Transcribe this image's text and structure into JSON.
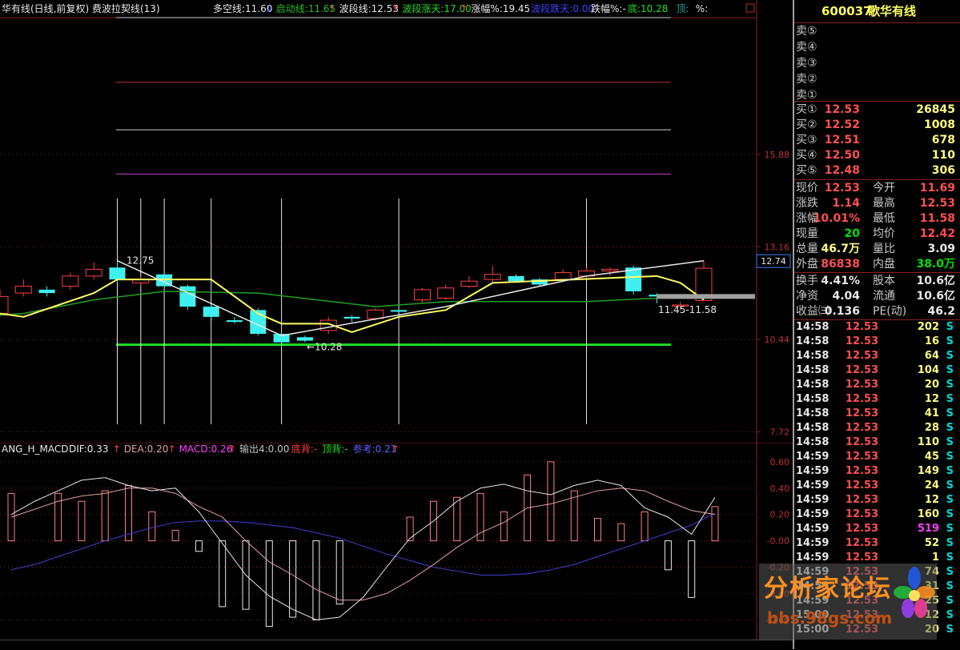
{
  "header": {
    "title": "华有线(日线,前复权) 费波拉契线(13)",
    "indicators": [
      {
        "label": "多空线:11.60",
        "arrow": "↓",
        "color": "#e8e8e8"
      },
      {
        "label": "启动线:11.65",
        "arrow": "↑",
        "color": "#20c020"
      },
      {
        "label": "波段线:12.53",
        "arrow": "↑",
        "color": "#e8e8e8"
      },
      {
        "label": "波段涨天:17.00",
        "arrow": "↑",
        "color": "#20e020"
      },
      {
        "label": "涨幅%:19.45",
        "arrow": "",
        "color": "#e8e8e8"
      },
      {
        "label": "波段跌天:0.00",
        "arrow": "",
        "color": "#4040ff"
      },
      {
        "label": "跌幅%:-",
        "arrow": "",
        "color": "#e8e8e8"
      },
      {
        "label": "底:10.28",
        "arrow": "",
        "color": "#20e020"
      },
      {
        "label": "顶:",
        "arrow": "",
        "color": "#20a0a0"
      },
      {
        "label": "%:",
        "arrow": "",
        "color": "#e8e8e8"
      }
    ]
  },
  "chart_data": [
    {
      "type": "candlestick",
      "title": "华有线(日线,前复权) 费波拉契线(13)",
      "y_ticks": [
        "15.88",
        "13.16",
        "10.44",
        "7.72"
      ],
      "current_price_tag": "12.74",
      "y_range": [
        7.4,
        19.9
      ],
      "annotations": {
        "high_label": "12.75",
        "low_label": "10.28",
        "range_label": "11.45-11.58"
      },
      "horizontal_levels": [
        {
          "value": 18.0,
          "color": "#c03030"
        },
        {
          "value": 16.6,
          "color": "#d0d0d0"
        },
        {
          "value": 15.3,
          "color": "#d040d0"
        },
        {
          "value": 10.28,
          "color": "#20e020"
        }
      ],
      "fib_vertical_days": [
        5,
        6,
        7,
        9,
        12,
        17,
        25,
        41
      ],
      "candles": [
        {
          "o": 11.2,
          "h": 11.9,
          "l": 11.1,
          "c": 11.7
        },
        {
          "o": 11.8,
          "h": 12.2,
          "l": 11.7,
          "c": 12.0
        },
        {
          "o": 11.9,
          "h": 12.0,
          "l": 11.7,
          "c": 11.8
        },
        {
          "o": 12.0,
          "h": 12.4,
          "l": 11.9,
          "c": 12.3
        },
        {
          "o": 12.3,
          "h": 12.7,
          "l": 12.2,
          "c": 12.5
        },
        {
          "o": 12.55,
          "h": 12.75,
          "l": 12.1,
          "c": 12.2
        },
        {
          "o": 12.1,
          "h": 12.3,
          "l": 12.0,
          "c": 12.2
        },
        {
          "o": 12.35,
          "h": 12.4,
          "l": 11.95,
          "c": 12.0
        },
        {
          "o": 12.0,
          "h": 12.05,
          "l": 11.3,
          "c": 11.4
        },
        {
          "o": 11.4,
          "h": 11.45,
          "l": 10.95,
          "c": 11.1
        },
        {
          "o": 11.0,
          "h": 11.1,
          "l": 10.9,
          "c": 10.95
        },
        {
          "o": 11.3,
          "h": 11.35,
          "l": 10.55,
          "c": 10.6
        },
        {
          "o": 10.6,
          "h": 10.65,
          "l": 10.28,
          "c": 10.35
        },
        {
          "o": 10.5,
          "h": 10.55,
          "l": 10.35,
          "c": 10.4
        },
        {
          "o": 10.7,
          "h": 11.1,
          "l": 10.6,
          "c": 11.0
        },
        {
          "o": 11.1,
          "h": 11.15,
          "l": 10.95,
          "c": 11.05
        },
        {
          "o": 11.05,
          "h": 11.35,
          "l": 11.0,
          "c": 11.3
        },
        {
          "o": 11.3,
          "h": 11.35,
          "l": 11.2,
          "c": 11.25
        },
        {
          "o": 11.6,
          "h": 11.95,
          "l": 11.5,
          "c": 11.9
        },
        {
          "o": 11.65,
          "h": 12.05,
          "l": 11.6,
          "c": 11.95
        },
        {
          "o": 12.0,
          "h": 12.3,
          "l": 11.95,
          "c": 12.15
        },
        {
          "o": 12.2,
          "h": 12.6,
          "l": 12.1,
          "c": 12.35
        },
        {
          "o": 12.3,
          "h": 12.35,
          "l": 12.1,
          "c": 12.15
        },
        {
          "o": 12.2,
          "h": 12.25,
          "l": 12.0,
          "c": 12.05
        },
        {
          "o": 12.2,
          "h": 12.5,
          "l": 12.15,
          "c": 12.4
        },
        {
          "o": 12.3,
          "h": 12.55,
          "l": 12.2,
          "c": 12.45
        },
        {
          "o": 12.45,
          "h": 12.55,
          "l": 12.3,
          "c": 12.5
        },
        {
          "o": 12.55,
          "h": 12.6,
          "l": 11.75,
          "c": 11.85
        },
        {
          "o": 11.75,
          "h": 11.8,
          "l": 11.5,
          "c": 11.7
        },
        {
          "o": 11.45,
          "h": 11.55,
          "l": 11.3,
          "c": 11.45
        },
        {
          "o": 11.58,
          "h": 12.74,
          "l": 11.58,
          "c": 12.53
        }
      ],
      "lines": [
        {
          "name": "启动线",
          "color": "#20a020",
          "points": [
            [
              0,
              11.15
            ],
            [
              1,
              11.2
            ],
            [
              4,
              11.6
            ],
            [
              7,
              11.85
            ],
            [
              11,
              11.8
            ],
            [
              16,
              11.4
            ],
            [
              19,
              11.55
            ],
            [
              25,
              11.55
            ],
            [
              28,
              11.65
            ],
            [
              30,
              11.65
            ]
          ]
        },
        {
          "name": "波段线",
          "color": "#ffff60",
          "points": [
            [
              0,
              11.2
            ],
            [
              1,
              11.1
            ],
            [
              4,
              11.8
            ],
            [
              5,
              12.2
            ],
            [
              9,
              12.2
            ],
            [
              11,
              11.2
            ],
            [
              12,
              10.9
            ],
            [
              14,
              10.9
            ],
            [
              15,
              10.65
            ],
            [
              17,
              11.1
            ],
            [
              19,
              11.3
            ],
            [
              21,
              12.1
            ],
            [
              28,
              12.3
            ],
            [
              29,
              12.1
            ],
            [
              30,
              11.6
            ]
          ]
        },
        {
          "name": "趋势线",
          "color": "#e8e8e8",
          "points": [
            [
              5,
              12.75
            ],
            [
              12,
              10.55
            ],
            [
              19,
              11.4
            ],
            [
              25,
              12.3
            ],
            [
              30,
              12.75
            ]
          ]
        }
      ]
    },
    {
      "type": "macd",
      "title": "ANG_H_MACD",
      "legend": [
        {
          "label": "DIF:0.33",
          "arrow": "↑",
          "color": "#e8e8e8"
        },
        {
          "label": "DEA:0.20",
          "arrow": "↑",
          "color": "#e0a0a0"
        },
        {
          "label": "MACD:0.26",
          "arrow": "↑",
          "color": "#ff40ff"
        },
        {
          "label": "输出4:0.00",
          "arrow": "",
          "color": "#c0c0c0"
        },
        {
          "label": "底背:-",
          "arrow": "",
          "color": "#ff4040"
        },
        {
          "label": "顶背:-",
          "arrow": "",
          "color": "#20e020"
        },
        {
          "label": "参考:0.21",
          "arrow": "↑",
          "color": "#6060ff"
        }
      ],
      "y_ticks": [
        "0.60",
        "0.40",
        "0.20",
        "-0.00",
        "-0.20",
        "-0.40",
        "-0.60"
      ],
      "y_range": [
        -0.75,
        0.66
      ],
      "hist": [
        0.36,
        0.0,
        0.36,
        0.3,
        0.38,
        0.42,
        0.22,
        0.08,
        -0.08,
        -0.5,
        -0.52,
        -0.65,
        -0.58,
        -0.6,
        -0.48,
        0.0,
        0.0,
        0.18,
        0.3,
        0.33,
        0.36,
        0.22,
        0.5,
        0.6,
        0.38,
        0.17,
        0.13,
        0.22,
        -0.22,
        -0.43,
        0.26
      ],
      "dif": [
        0.2,
        0.3,
        0.38,
        0.46,
        0.48,
        0.42,
        0.38,
        0.4,
        0.22,
        -0.02,
        -0.26,
        -0.42,
        -0.52,
        -0.6,
        -0.58,
        -0.43,
        -0.2,
        0.02,
        0.15,
        0.3,
        0.4,
        0.43,
        0.38,
        0.35,
        0.42,
        0.46,
        0.42,
        0.25,
        0.18,
        0.05,
        0.33
      ],
      "dea": [
        0.18,
        0.24,
        0.3,
        0.34,
        0.36,
        0.4,
        0.4,
        0.36,
        0.26,
        0.18,
        0.0,
        -0.16,
        -0.26,
        -0.37,
        -0.45,
        -0.45,
        -0.4,
        -0.3,
        -0.18,
        -0.05,
        0.06,
        0.14,
        0.25,
        0.28,
        0.33,
        0.38,
        0.4,
        0.38,
        0.3,
        0.23,
        0.2
      ],
      "ref": [
        -0.22,
        -0.18,
        -0.12,
        -0.06,
        0.0,
        0.05,
        0.1,
        0.14,
        0.15,
        0.15,
        0.14,
        0.12,
        0.1,
        0.06,
        0.02,
        -0.04,
        -0.1,
        -0.15,
        -0.2,
        -0.23,
        -0.26,
        -0.26,
        -0.25,
        -0.22,
        -0.18,
        -0.12,
        -0.06,
        0.0,
        0.06,
        0.12,
        0.21
      ]
    }
  ],
  "quote": {
    "code": "600037",
    "name": "歌华有线",
    "sell": [
      {
        "label": "卖⑤",
        "price": "",
        "vol": ""
      },
      {
        "label": "卖④",
        "price": "",
        "vol": ""
      },
      {
        "label": "卖③",
        "price": "",
        "vol": ""
      },
      {
        "label": "卖②",
        "price": "",
        "vol": ""
      },
      {
        "label": "卖①",
        "price": "",
        "vol": ""
      }
    ],
    "buy": [
      {
        "label": "买①",
        "price": "12.53",
        "vol": "26845"
      },
      {
        "label": "买②",
        "price": "12.52",
        "vol": "1008"
      },
      {
        "label": "买③",
        "price": "12.51",
        "vol": "678"
      },
      {
        "label": "买④",
        "price": "12.50",
        "vol": "110"
      },
      {
        "label": "买⑤",
        "price": "12.48",
        "vol": "306"
      }
    ],
    "stats": [
      {
        "l1": "现价",
        "v1": "12.53",
        "c1": "red",
        "l2": "今开",
        "v2": "11.69",
        "c2": "red"
      },
      {
        "l1": "涨跌",
        "v1": "1.14",
        "c1": "red",
        "l2": "最高",
        "v2": "12.53",
        "c2": "red"
      },
      {
        "l1": "涨幅",
        "v1": "10.01%",
        "c1": "red",
        "l2": "最低",
        "v2": "11.58",
        "c2": "red"
      },
      {
        "l1": "现量",
        "v1": "20",
        "c1": "grn",
        "l2": "均价",
        "v2": "12.42",
        "c2": "red"
      },
      {
        "l1": "总量",
        "v1": "46.7万",
        "c1": "yel",
        "l2": "量比",
        "v2": "3.09",
        "c2": "wht"
      },
      {
        "l1": "外盘",
        "v1": "86838",
        "c1": "red",
        "l2": "内盘",
        "v2": "38.0万",
        "c2": "grn"
      }
    ],
    "stats2": [
      {
        "l1": "换手",
        "v1": "4.41%",
        "c1": "wht",
        "l2": "股本",
        "v2": "10.6亿",
        "c2": "wht"
      },
      {
        "l1": "净资",
        "v1": "4.04",
        "c1": "wht",
        "l2": "流通",
        "v2": "10.6亿",
        "c2": "wht"
      },
      {
        "l1": "收益㈢",
        "v1": "0.136",
        "c1": "wht",
        "l2": "PE(动)",
        "v2": "46.2",
        "c2": "wht"
      }
    ],
    "ticks": [
      {
        "time": "14:58",
        "price": "12.53",
        "vol": "202",
        "bs": "S"
      },
      {
        "time": "14:58",
        "price": "12.53",
        "vol": "16",
        "bs": "S"
      },
      {
        "time": "14:58",
        "price": "12.53",
        "vol": "64",
        "bs": "S"
      },
      {
        "time": "14:58",
        "price": "12.53",
        "vol": "104",
        "bs": "S"
      },
      {
        "time": "14:58",
        "price": "12.53",
        "vol": "20",
        "bs": "S"
      },
      {
        "time": "14:58",
        "price": "12.53",
        "vol": "12",
        "bs": "S"
      },
      {
        "time": "14:58",
        "price": "12.53",
        "vol": "41",
        "bs": "S"
      },
      {
        "time": "14:58",
        "price": "12.53",
        "vol": "28",
        "bs": "S"
      },
      {
        "time": "14:58",
        "price": "12.53",
        "vol": "110",
        "bs": "S"
      },
      {
        "time": "14:59",
        "price": "12.53",
        "vol": "45",
        "bs": "S"
      },
      {
        "time": "14:59",
        "price": "12.53",
        "vol": "149",
        "bs": "S"
      },
      {
        "time": "14:59",
        "price": "12.53",
        "vol": "24",
        "bs": "S"
      },
      {
        "time": "14:59",
        "price": "12.53",
        "vol": "12",
        "bs": "S"
      },
      {
        "time": "14:59",
        "price": "12.53",
        "vol": "160",
        "bs": "S"
      },
      {
        "time": "14:59",
        "price": "12.53",
        "vol": "519",
        "bs": "S",
        "highlight": true
      },
      {
        "time": "14:59",
        "price": "12.53",
        "vol": "52",
        "bs": "S"
      },
      {
        "time": "14:59",
        "price": "12.53",
        "vol": "1",
        "bs": "S"
      },
      {
        "time": "14:59",
        "price": "12.53",
        "vol": "74",
        "bs": "S"
      },
      {
        "time": "14:59",
        "price": "12.53",
        "vol": "31",
        "bs": "S"
      },
      {
        "time": "14:59",
        "price": "12.53",
        "vol": "25",
        "bs": "S"
      },
      {
        "time": "15:00",
        "price": "12.53",
        "vol": "12",
        "bs": "S"
      },
      {
        "time": "15:00",
        "price": "12.53",
        "vol": "20",
        "bs": "S"
      }
    ]
  },
  "watermark": {
    "title": "分析家论坛",
    "url": "bbs.98gs.com"
  },
  "colors": {
    "up_candle": "#ff4040",
    "down_candle": "#40f0f0",
    "grid": "#8a2020"
  }
}
